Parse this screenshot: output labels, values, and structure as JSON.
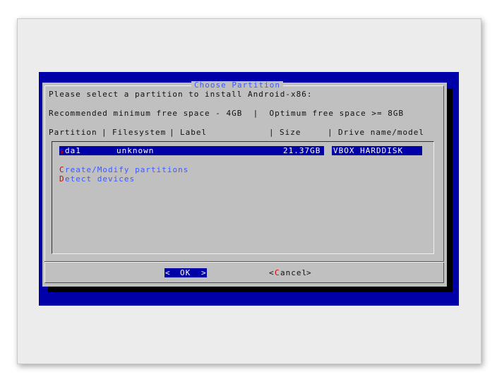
{
  "dialog": {
    "title": "Choose Partition",
    "prompt": "Please select a partition to install Android-x86:",
    "recommend": "Recommended minimum free space - 4GB  |  Optimum free space >= 8GB",
    "columns": {
      "partition": "Partition",
      "filesystem": "Filesystem",
      "label": "Label",
      "size": "Size",
      "drive": "Drive name/model"
    },
    "separator": "|"
  },
  "partitions": [
    {
      "name_hot": "s",
      "name_rest": "da1",
      "filesystem": "unknown",
      "size": "21.37GB",
      "drive": "VBOX HARDDISK"
    }
  ],
  "options": [
    {
      "hot": "C",
      "rest": "reate/Modify partitions"
    },
    {
      "hot": "D",
      "rest": "etect devices"
    }
  ],
  "buttons": {
    "ok_left": "<",
    "ok_label": "OK",
    "ok_right": ">",
    "cancel_left": "<",
    "cancel_hot": "C",
    "cancel_rest": "ancel",
    "cancel_right": ">"
  },
  "colors": {
    "terminal_bg": "#0000a8",
    "dialog_bg": "#c0c0c0",
    "highlight": "#0000a8",
    "hotkey": "#d40000",
    "title": "#3c5aff"
  }
}
